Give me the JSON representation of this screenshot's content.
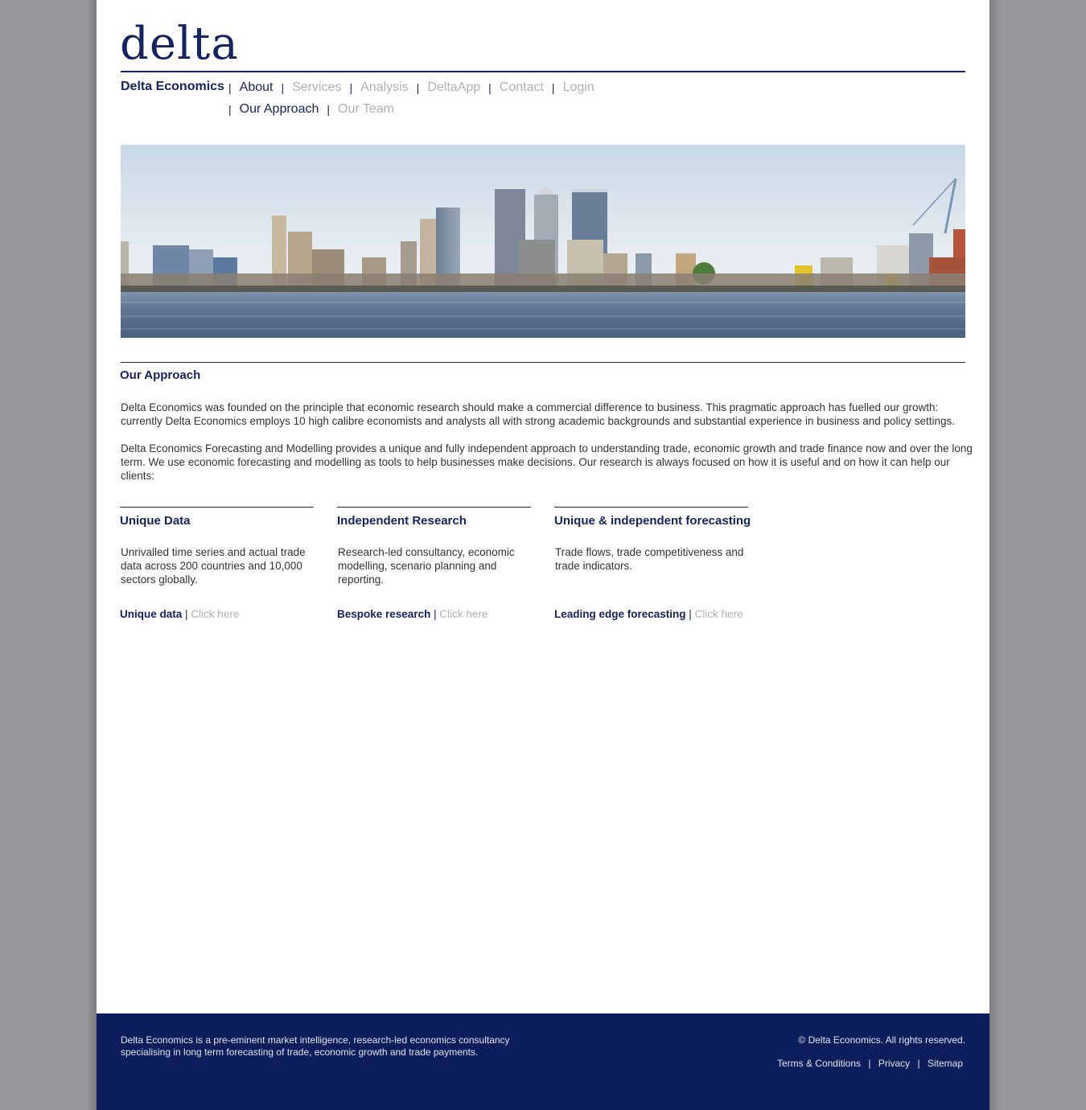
{
  "logo": {
    "text": "delta"
  },
  "nav": {
    "brand": "Delta Economics",
    "separator": "|",
    "primary": [
      {
        "label": "About",
        "state": "active"
      },
      {
        "label": "Services",
        "state": "inactive"
      },
      {
        "label": "Analysis",
        "state": "inactive"
      },
      {
        "label": "DeltaApp",
        "state": "inactive"
      },
      {
        "label": "Contact",
        "state": "inactive"
      },
      {
        "label": "Login",
        "state": "inactive"
      }
    ],
    "secondary": [
      {
        "label": "Our Approach",
        "state": "active"
      },
      {
        "label": "Our Team",
        "state": "inactive"
      }
    ]
  },
  "hero": {
    "subject": "city-skyline-river-panorama"
  },
  "main": {
    "title": "Our Approach",
    "paragraphs": [
      "Delta Economics was founded on the principle that economic research should make a commercial difference to business. This pragmatic approach has fuelled our growth: currently Delta Economics employs 10 high calibre economists and analysts all with strong academic backgrounds and substantial experience in business and policy settings.",
      "Delta Economics Forecasting and Modelling provides a unique and fully independent approach to understanding trade, economic growth and trade finance now and over the long term. We use economic forecasting and modelling as tools to help businesses make decisions. Our research is always focused on how it is useful and on how it can help our clients:"
    ],
    "columns": [
      {
        "title": "Unique Data",
        "body": "Unrivalled time series and actual trade data across 200 countries and 10,000 sectors globally.",
        "link_strong": "Unique data",
        "link_sep": "|",
        "link_action": "Click here"
      },
      {
        "title": "Independent Research",
        "body": "Research-led consultancy, economic modelling, scenario planning and reporting.",
        "link_strong": "Bespoke research",
        "link_sep": "|",
        "link_action": "Click here"
      },
      {
        "title": "Unique & independent forecasting",
        "body": "Trade flows, trade competitiveness and trade indicators.",
        "link_strong": "Leading edge forecasting",
        "link_sep": "|",
        "link_action": "Click here"
      }
    ]
  },
  "footer": {
    "about_line1": "Delta Economics is a pre-eminent market intelligence, research-led economics consultancy",
    "about_line2": "specialising in long term forecasting of trade, economic growth and trade payments.",
    "copyright": "© Delta Economics. All rights reserved.",
    "links": [
      "Terms & Conditions",
      "Privacy",
      "Sitemap"
    ],
    "link_sep": "|"
  },
  "colors": {
    "navy": "#15235e",
    "footer_bg": "#0c1e5c",
    "muted": "#b0b0b0",
    "outer_bg": "#97979c"
  }
}
